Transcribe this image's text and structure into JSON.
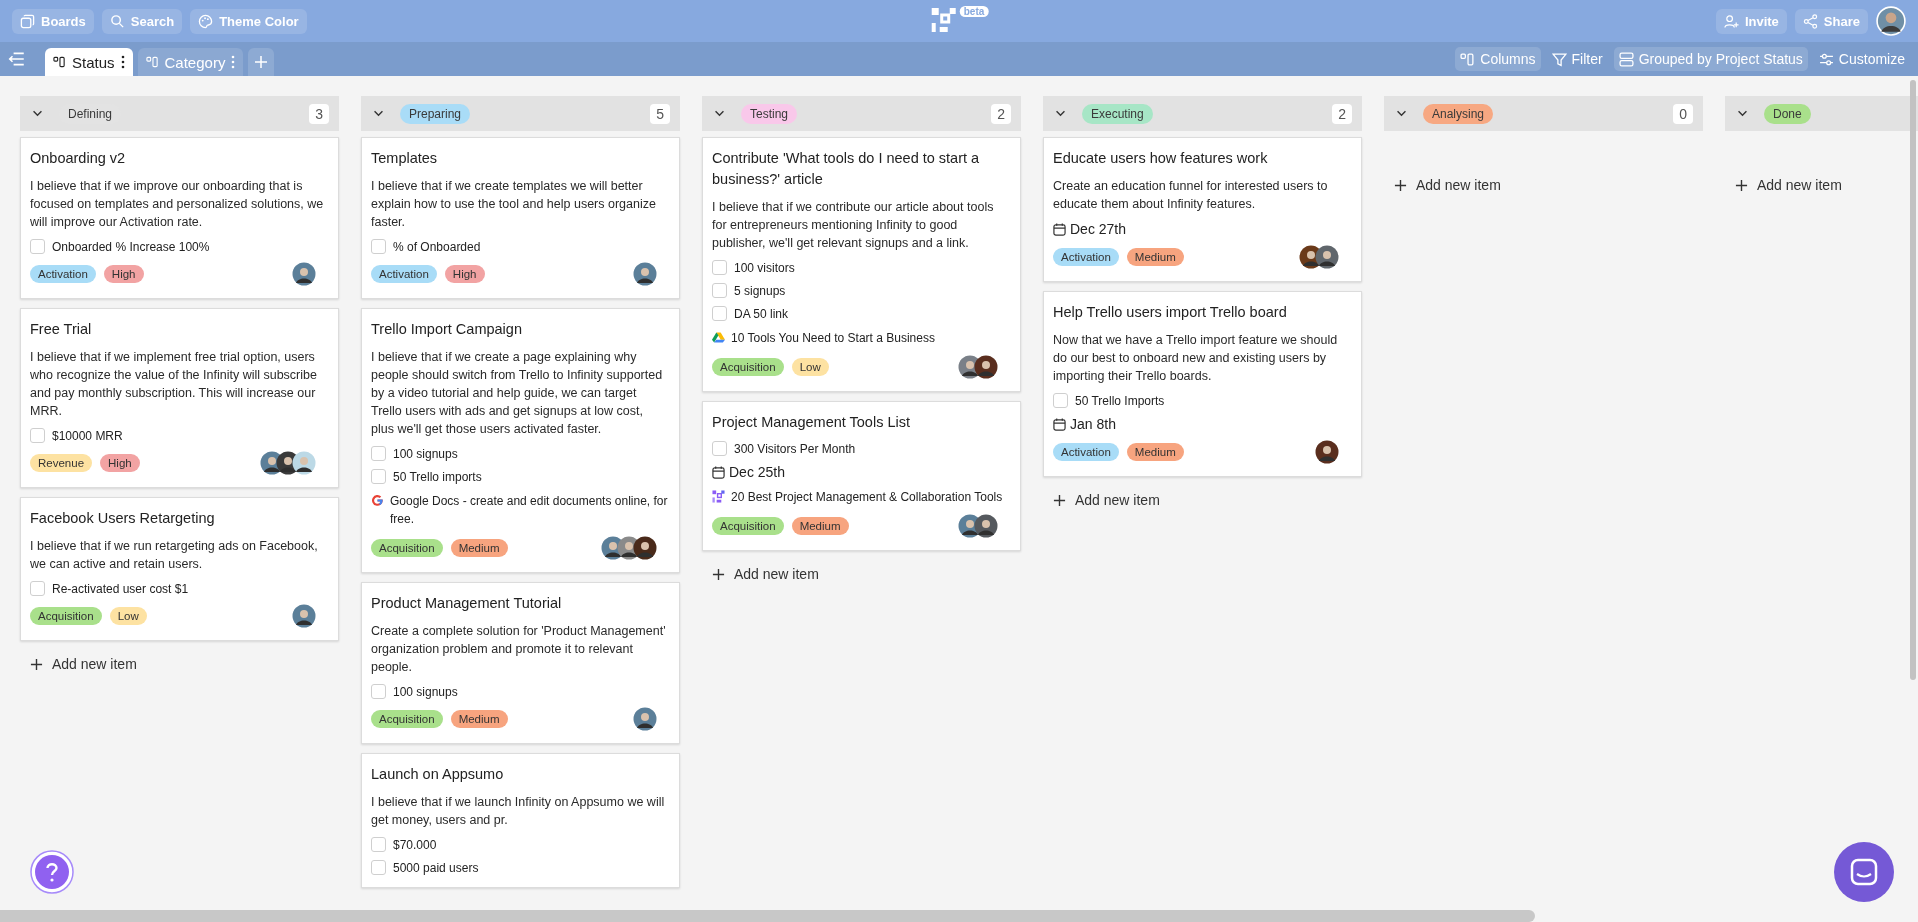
{
  "topbar": {
    "left_buttons": [
      {
        "kind": "boards",
        "label": "Boards"
      },
      {
        "kind": "search",
        "label": "Search"
      },
      {
        "kind": "palette",
        "label": "Theme Color"
      }
    ],
    "logo_badge": "beta",
    "right_buttons": [
      {
        "kind": "invite",
        "label": "Invite"
      },
      {
        "kind": "share",
        "label": "Share"
      }
    ]
  },
  "viewbar": {
    "tabs": [
      {
        "label": "Status",
        "selected": true
      },
      {
        "label": "Category",
        "selected": false
      }
    ],
    "tools": [
      {
        "kind": "columns",
        "label": "Columns"
      },
      {
        "kind": "filter",
        "label": "Filter"
      },
      {
        "kind": "group",
        "label": "Grouped by Project Status"
      },
      {
        "kind": "customize",
        "label": "Customize"
      }
    ]
  },
  "columns": [
    {
      "status": "Defining",
      "color": "#e3e3e3",
      "count": "3",
      "add_label": "Add new item",
      "cards": [
        {
          "title": "Onboarding v2",
          "description": "I believe that if we improve our onboarding that is focused on templates and personalized solutions, we will improve our Activation rate.",
          "checklist": [
            {
              "label": "Onboarded % Increase 100%",
              "checked": false
            }
          ],
          "tags": [
            {
              "label": "Activation",
              "color": "#a8dcf7"
            },
            {
              "label": "High",
              "color": "#f2a3a3"
            }
          ],
          "avatars": [
            {
              "color": "#5b7f99"
            }
          ]
        },
        {
          "title": "Free Trial",
          "description": "I believe that if we implement free trial option, users who recognize the value of the Infinity will subscribe and pay monthly subscription. This will increase our MRR.",
          "checklist": [
            {
              "label": "$10000 MRR",
              "checked": false
            }
          ],
          "tags": [
            {
              "label": "Revenue",
              "color": "#fde2a2"
            },
            {
              "label": "High",
              "color": "#f2a3a3"
            }
          ],
          "avatars": [
            {
              "color": "#5b7f99"
            },
            {
              "color": "#3a3a3a"
            },
            {
              "color": "#bcd9e6"
            }
          ]
        },
        {
          "title": "Facebook Users Retargeting",
          "description": "I believe that if we run retargeting ads on Facebook, we can active and retain users.",
          "checklist": [
            {
              "label": "Re-activated user cost $1",
              "checked": false
            }
          ],
          "tags": [
            {
              "label": "Acquisition",
              "color": "#a9e08b"
            },
            {
              "label": "Low",
              "color": "#fde2a2"
            }
          ],
          "avatars": [
            {
              "color": "#5b7f99"
            }
          ]
        }
      ]
    },
    {
      "status": "Preparing",
      "color": "#a9dcf7",
      "count": "5",
      "cards": [
        {
          "title": "Templates",
          "description": "I believe that if we create templates we will better explain how to use the tool and help users organize faster.",
          "checklist": [
            {
              "label": "% of Onboarded",
              "checked": false
            }
          ],
          "tags": [
            {
              "label": "Activation",
              "color": "#a8dcf7"
            },
            {
              "label": "High",
              "color": "#f2a3a3"
            }
          ],
          "avatars": [
            {
              "color": "#5b7f99"
            }
          ]
        },
        {
          "title": "Trello Import Campaign",
          "description": "I believe that if we create a page explaining why people should switch from Trello to Infinity supported by a video tutorial and help guide, we can target Trello users with ads and get signups at low cost, plus we'll get those users activated faster.",
          "checklist": [
            {
              "label": "100 signups",
              "checked": false
            },
            {
              "label": "50 Trello imports",
              "checked": false
            }
          ],
          "link": {
            "kind": "google",
            "text": "Google Docs - create and edit documents online, for free."
          },
          "tags": [
            {
              "label": "Acquisition",
              "color": "#a9e08b"
            },
            {
              "label": "Medium",
              "color": "#f7a47f"
            }
          ],
          "avatars": [
            {
              "color": "#5b7f99"
            },
            {
              "color": "#8a8a8a"
            },
            {
              "color": "#4a2a1a"
            }
          ]
        },
        {
          "title": "Product Management Tutorial",
          "description": "Create a complete solution for 'Product Management' organization problem and promote it to relevant people.",
          "checklist": [
            {
              "label": "100 signups",
              "checked": false
            }
          ],
          "tags": [
            {
              "label": "Acquisition",
              "color": "#a9e08b"
            },
            {
              "label": "Medium",
              "color": "#f7a47f"
            }
          ],
          "avatars": [
            {
              "color": "#5b7f99"
            }
          ]
        },
        {
          "title": "Launch on Appsumo",
          "description": "I believe that if we launch Infinity on Appsumo we will get money, users and pr.",
          "checklist": [
            {
              "label": "$70.000",
              "checked": false
            },
            {
              "label": "5000 paid users",
              "checked": false
            }
          ]
        }
      ]
    },
    {
      "status": "Testing",
      "color": "#f9c8ea",
      "count": "2",
      "add_label": "Add new item",
      "cards": [
        {
          "title": "Contribute 'What tools do I need to start a business?' article",
          "description": "I believe that if we contribute our article about tools for entrepreneurs mentioning Infinity to good publisher, we'll get relevant signups and a link.",
          "checklist": [
            {
              "label": "100 visitors",
              "checked": false
            },
            {
              "label": "5 signups",
              "checked": false
            },
            {
              "label": "DA 50 link",
              "checked": false
            }
          ],
          "link": {
            "kind": "drive",
            "text": "10 Tools You Need to Start a Business"
          },
          "tags": [
            {
              "label": "Acquisition",
              "color": "#a9e08b"
            },
            {
              "label": "Low",
              "color": "#fde2a2"
            }
          ],
          "avatars": [
            {
              "color": "#7a8088"
            },
            {
              "color": "#5a2e1e"
            }
          ]
        },
        {
          "title": "Project Management Tools List",
          "checklist": [
            {
              "label": "300 Visitors Per Month",
              "checked": false
            }
          ],
          "date": "Dec 25th",
          "link": {
            "kind": "logo",
            "text": "20 Best Project Management & Collaboration Tools"
          },
          "tags": [
            {
              "label": "Acquisition",
              "color": "#a9e08b"
            },
            {
              "label": "Medium",
              "color": "#f7a47f"
            }
          ],
          "avatars": [
            {
              "color": "#5b7f99"
            },
            {
              "color": "#55595e"
            }
          ]
        }
      ]
    },
    {
      "status": "Executing",
      "color": "#a7e6c6",
      "count": "2",
      "add_label": "Add new item",
      "cards": [
        {
          "title": "Educate users how features work",
          "description": "Create an education funnel for interested users to educate them about Infinity features.",
          "date": "Dec 27th",
          "tags": [
            {
              "label": "Activation",
              "color": "#a8dcf7"
            },
            {
              "label": "Medium",
              "color": "#f7a47f"
            }
          ],
          "avatars": [
            {
              "color": "#6b3a1a"
            },
            {
              "color": "#60666c"
            }
          ]
        },
        {
          "title": "Help Trello users import Trello board",
          "description": "Now that we have a Trello import feature we should do our best to onboard new and existing users by importing their Trello boards.",
          "checklist": [
            {
              "label": "50 Trello Imports",
              "checked": false
            }
          ],
          "date": "Jan 8th",
          "tags": [
            {
              "label": "Activation",
              "color": "#a8dcf7"
            },
            {
              "label": "Medium",
              "color": "#f7a47f"
            }
          ],
          "avatars": [
            {
              "color": "#5a2e1e"
            }
          ]
        }
      ]
    },
    {
      "status": "Analysing",
      "color": "#f7a882",
      "count": "0",
      "add_label": "Add new item"
    },
    {
      "status": "Done",
      "color": "#a9e08b",
      "add_label": "Add new item"
    }
  ]
}
